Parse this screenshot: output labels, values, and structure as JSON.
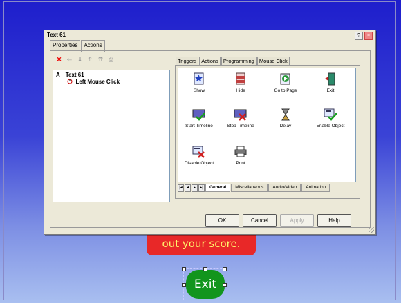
{
  "dialog": {
    "title": "Text 61",
    "property_tabs": [
      {
        "label": "Properties"
      },
      {
        "label": "Actions"
      }
    ],
    "tree": {
      "root": "Text 61",
      "root_marker": "A",
      "child": "Left Mouse Click"
    },
    "action_tabs": [
      {
        "label": "Triggers"
      },
      {
        "label": "Actions"
      },
      {
        "label": "Programming"
      },
      {
        "label": "Mouse Click"
      }
    ],
    "actions": [
      {
        "label": "Show",
        "icon": "show-icon"
      },
      {
        "label": "Hide",
        "icon": "hide-icon"
      },
      {
        "label": "Go to Page",
        "icon": "go-to-page-icon"
      },
      {
        "label": "Exit",
        "icon": "exit-door-icon"
      },
      {
        "label": "Start Timeline",
        "icon": "start-timeline-icon"
      },
      {
        "label": "Stop Timeline",
        "icon": "stop-timeline-icon"
      },
      {
        "label": "Delay",
        "icon": "hourglass-icon"
      },
      {
        "label": "Enable Object",
        "icon": "enable-object-icon"
      },
      {
        "label": "Disable Object",
        "icon": "disable-object-icon"
      },
      {
        "label": "Print",
        "icon": "printer-icon"
      }
    ],
    "category_tabs": [
      {
        "label": "General"
      },
      {
        "label": "Miscellaneous"
      },
      {
        "label": "Audio/Video"
      },
      {
        "label": "Animation"
      }
    ],
    "buttons": {
      "ok": "OK",
      "cancel": "Cancel",
      "apply": "Apply",
      "help": "Help"
    }
  },
  "page": {
    "banner_text": "out your score.",
    "exit_label": "Exit"
  },
  "colors": {
    "background": "#2323c8",
    "banner": "#e82828",
    "banner_text": "#fff36b",
    "exit_button": "#12951d"
  }
}
